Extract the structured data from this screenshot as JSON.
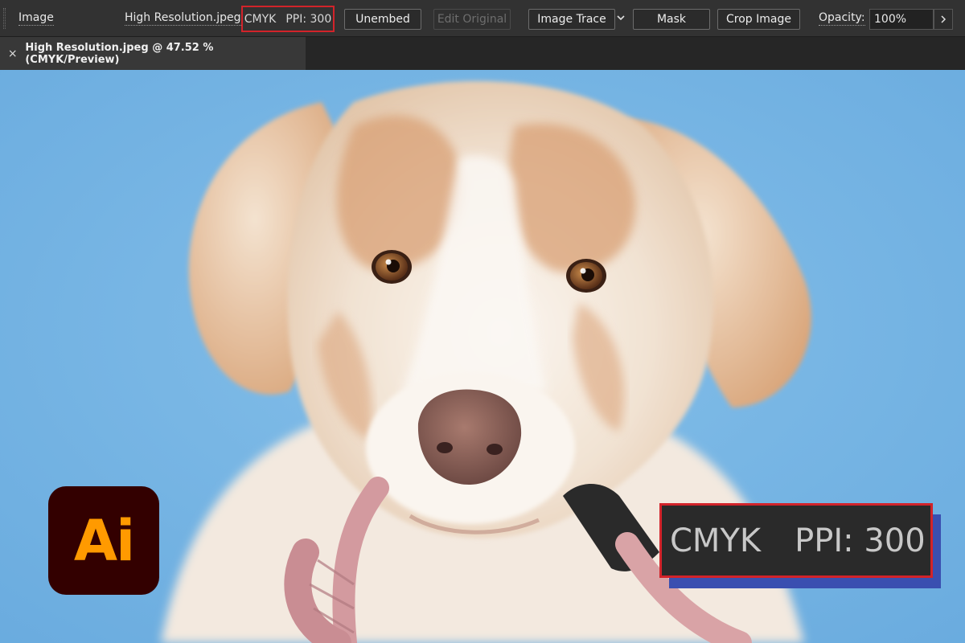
{
  "control_bar": {
    "section_label": "Image",
    "file_link": "High Resolution.jpeg",
    "color_mode": "CMYK",
    "ppi": "PPI: 300",
    "buttons": {
      "unembed": "Unembed",
      "edit_original": "Edit Original",
      "image_trace": "Image Trace",
      "mask": "Mask",
      "crop_image": "Crop Image"
    },
    "opacity_label": "Opacity:",
    "opacity_value": "100%"
  },
  "document_tab": {
    "title": "High Resolution.jpeg @ 47.52 % (CMYK/Preview)",
    "close_glyph": "×"
  },
  "logo": {
    "text": "Ai",
    "bg": "#330000",
    "fg": "#ff9a00"
  },
  "callout": {
    "color_mode": "CMYK",
    "ppi": "PPI: 300"
  },
  "colors": {
    "highlight_border": "#d2232a",
    "canvas_background": "#6fb1e2"
  }
}
